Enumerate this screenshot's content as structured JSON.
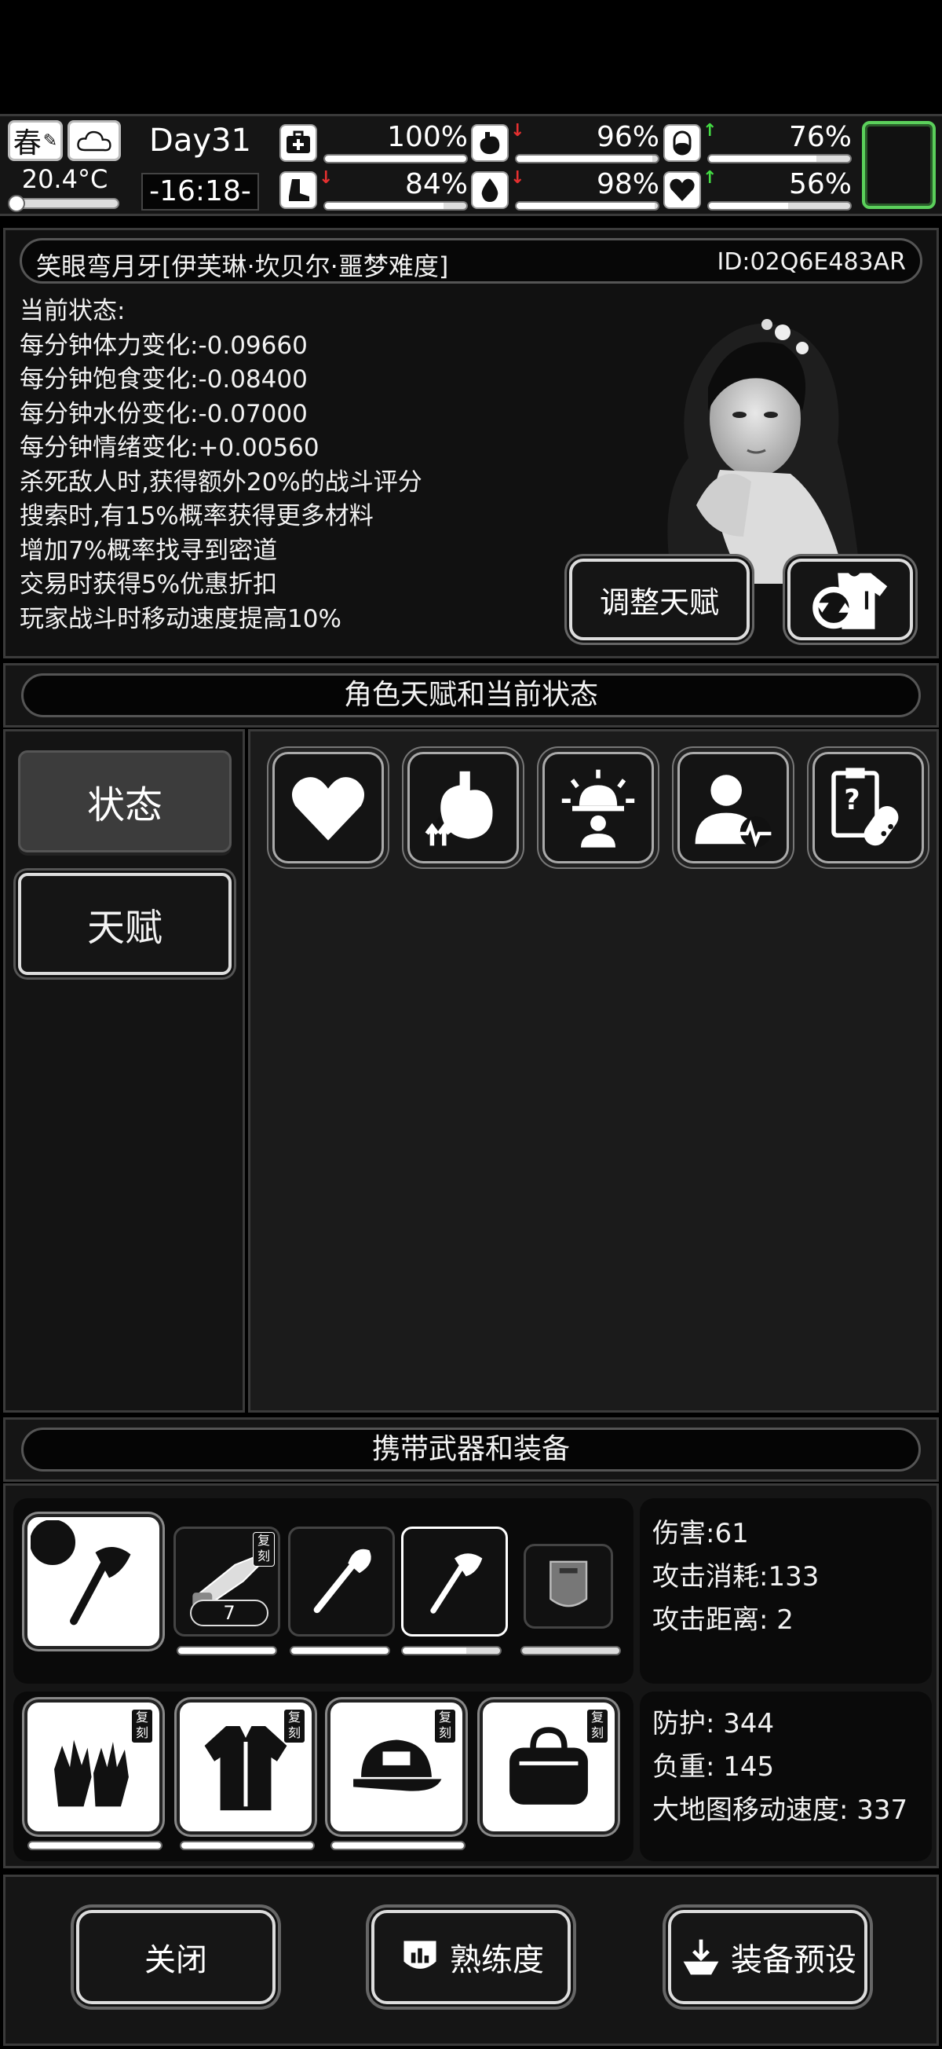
{
  "hud": {
    "season": "春",
    "temperature": "20.4°C",
    "day": "Day31",
    "time": "-16:18-",
    "stats": [
      {
        "name": "health",
        "icon": "medkit-icon",
        "value": "100%",
        "level": 1.0,
        "trend": ""
      },
      {
        "name": "satiety",
        "icon": "stomach-icon",
        "value": "96%",
        "level": 0.96,
        "trend": "down"
      },
      {
        "name": "energy",
        "icon": "pill-icon",
        "value": "76%",
        "level": 0.76,
        "trend": "up"
      },
      {
        "name": "stamina",
        "icon": "boot-icon",
        "value": "84%",
        "level": 0.84,
        "trend": "down"
      },
      {
        "name": "hydration",
        "icon": "water-drop-icon",
        "value": "98%",
        "level": 0.98,
        "trend": "down"
      },
      {
        "name": "mood",
        "icon": "heart-icon",
        "value": "56%",
        "level": 0.56,
        "trend": "up"
      }
    ]
  },
  "character": {
    "name": "笑眼弯月牙[伊芙琳·坎贝尔·噩梦难度]",
    "id": "ID:02Q6E483AR",
    "status_title": "当前状态:",
    "status_lines": [
      "每分钟体力变化:-0.09660",
      "每分钟饱食变化:-0.08400",
      "每分钟水份变化:-0.07000",
      "每分钟情绪变化:+0.00560",
      "杀死敌人时,获得额外20%的战斗评分",
      "搜索时,有15%概率获得更多材料",
      "增加7%概率找寻到密道",
      "交易时获得5%优惠折扣",
      "玩家战斗时移动速度提高10%"
    ],
    "adjust_talent_label": "调整天赋"
  },
  "talent_section": {
    "title": "角色天赋和当前状态",
    "tabs": [
      "状态",
      "天赋"
    ],
    "status_icons": [
      "heart-icon",
      "stomach-boost-icon",
      "alarm-person-icon",
      "person-heartbeat-icon",
      "medical-report-icon"
    ]
  },
  "equipment": {
    "title": "携带武器和装备",
    "weapon_stats": [
      "伤害:61",
      "攻击消耗:133",
      "攻击距离: 2"
    ],
    "gear_stats": [
      "防护: 344",
      "负重: 145",
      "大地图移动速度: 337"
    ],
    "ammo_count": "7",
    "badge_label": "复刻"
  },
  "bottom": {
    "close_label": "关闭",
    "proficiency_label": "熟练度",
    "preset_label": "装备预设"
  }
}
